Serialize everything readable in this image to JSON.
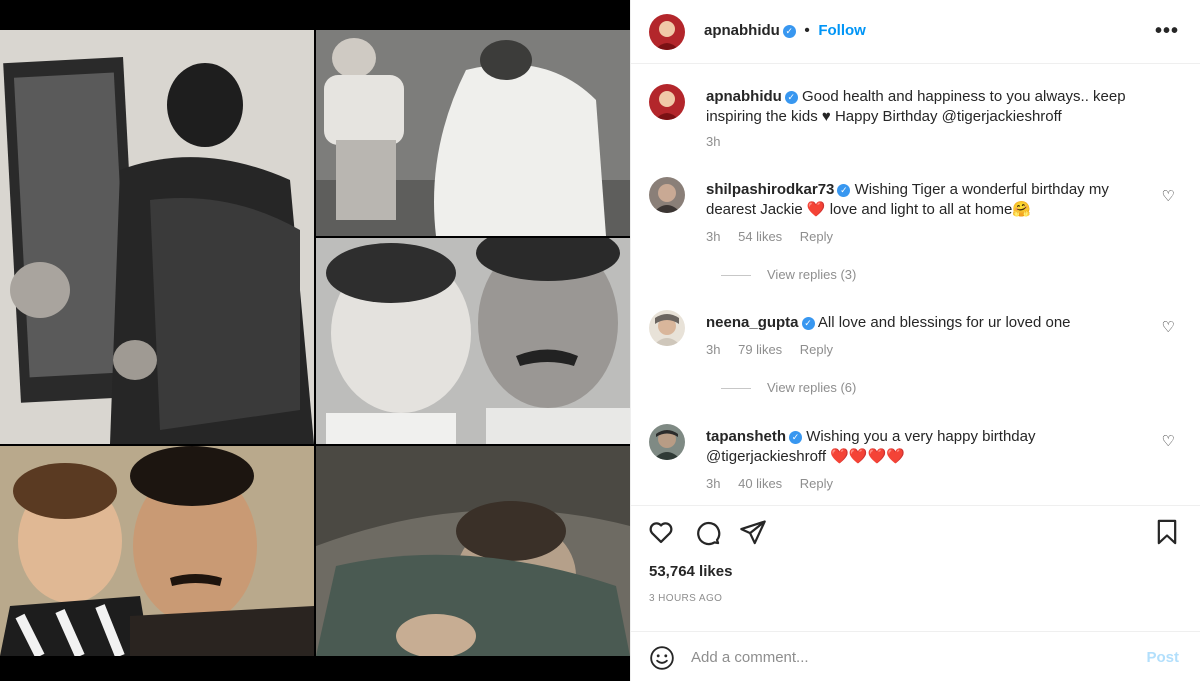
{
  "post": {
    "author": "apnabhidu",
    "follow_label": "Follow",
    "more_icon": "more-options-icon",
    "likes": "53,764 likes",
    "time_ago": "3 HOURS AGO"
  },
  "caption": {
    "user": "apnabhidu",
    "text": "Good health and happiness to you always.. keep inspiring the kids ♥ Happy Birthday @tigerjackieshroff",
    "time": "3h"
  },
  "comments": [
    {
      "user": "shilpashirodkar73",
      "text": "Wishing Tiger a wonderful birthday my dearest Jackie ❤️ love and light to all at home🤗",
      "time": "3h",
      "likes": "54 likes",
      "reply_label": "Reply",
      "view_replies": "View replies (3)"
    },
    {
      "user": "neena_gupta",
      "text": "All love and blessings for ur loved one",
      "time": "3h",
      "likes": "79 likes",
      "reply_label": "Reply",
      "view_replies": "View replies (6)"
    },
    {
      "user": "tapansheth",
      "text": "Wishing you a very happy birthday @tigerjackieshroff ❤️❤️❤️❤️",
      "time": "3h",
      "likes": "40 likes",
      "reply_label": "Reply"
    }
  ],
  "composer": {
    "placeholder": "Add a comment...",
    "post_label": "Post"
  },
  "colors": {
    "accent": "#0095f6",
    "verified": "#3897f0",
    "muted": "#8e8e8e",
    "post_disabled": "#b2dffc"
  }
}
